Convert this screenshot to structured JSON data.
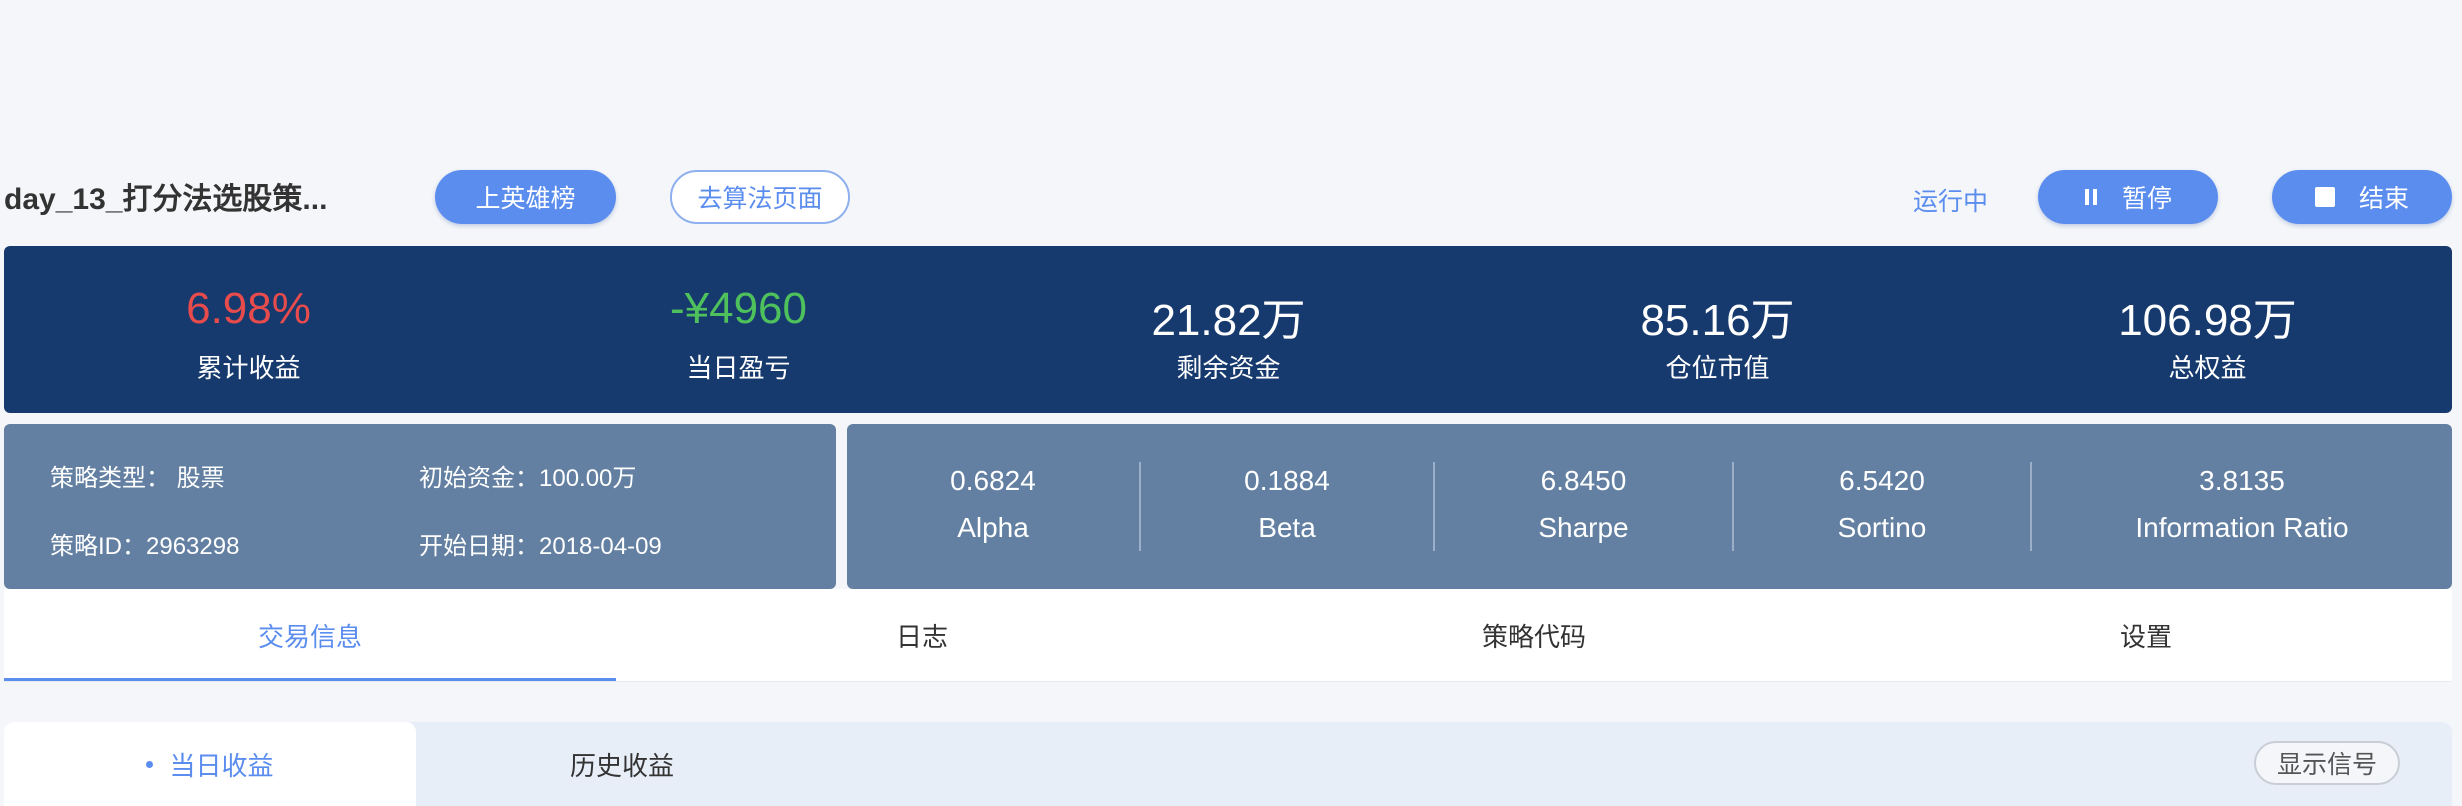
{
  "header": {
    "strategy_title": "day_13_打分法选股策...",
    "leaderboard_button": "上英雄榜",
    "algorithm_page_button": "去算法页面",
    "status": "运行中",
    "pause_button": "暂停",
    "stop_button": "结束"
  },
  "summary": [
    {
      "value": "6.98%",
      "label": "累计收益",
      "color": "#e84b4b"
    },
    {
      "value": "-¥4960",
      "label": "当日盈亏",
      "color": "#4fc15c"
    },
    {
      "value": "21.82万",
      "label": "剩余资金",
      "color": "#ffffff"
    },
    {
      "value": "85.16万",
      "label": "仓位市值",
      "color": "#ffffff"
    },
    {
      "value": "106.98万",
      "label": "总权益",
      "color": "#ffffff"
    }
  ],
  "info": {
    "strategy_type": "策略类型： 股票",
    "initial_capital": "初始资金：100.00万",
    "strategy_id": "策略ID：2963298",
    "start_date": "开始日期：2018-04-09"
  },
  "metrics": [
    {
      "value": "0.6824",
      "label": "Alpha"
    },
    {
      "value": "0.1884",
      "label": "Beta"
    },
    {
      "value": "6.8450",
      "label": "Sharpe"
    },
    {
      "value": "6.5420",
      "label": "Sortino"
    },
    {
      "value": "3.8135",
      "label": "Information Ratio"
    }
  ],
  "tabs": [
    "交易信息",
    "日志",
    "策略代码",
    "设置"
  ],
  "subtabs": {
    "active": "当日收益",
    "other": "历史收益",
    "signal_button": "显示信号"
  },
  "colors": {
    "accent": "#5b8def",
    "summary_bg": "#173a6e",
    "panel_bg": "#6380a2"
  }
}
